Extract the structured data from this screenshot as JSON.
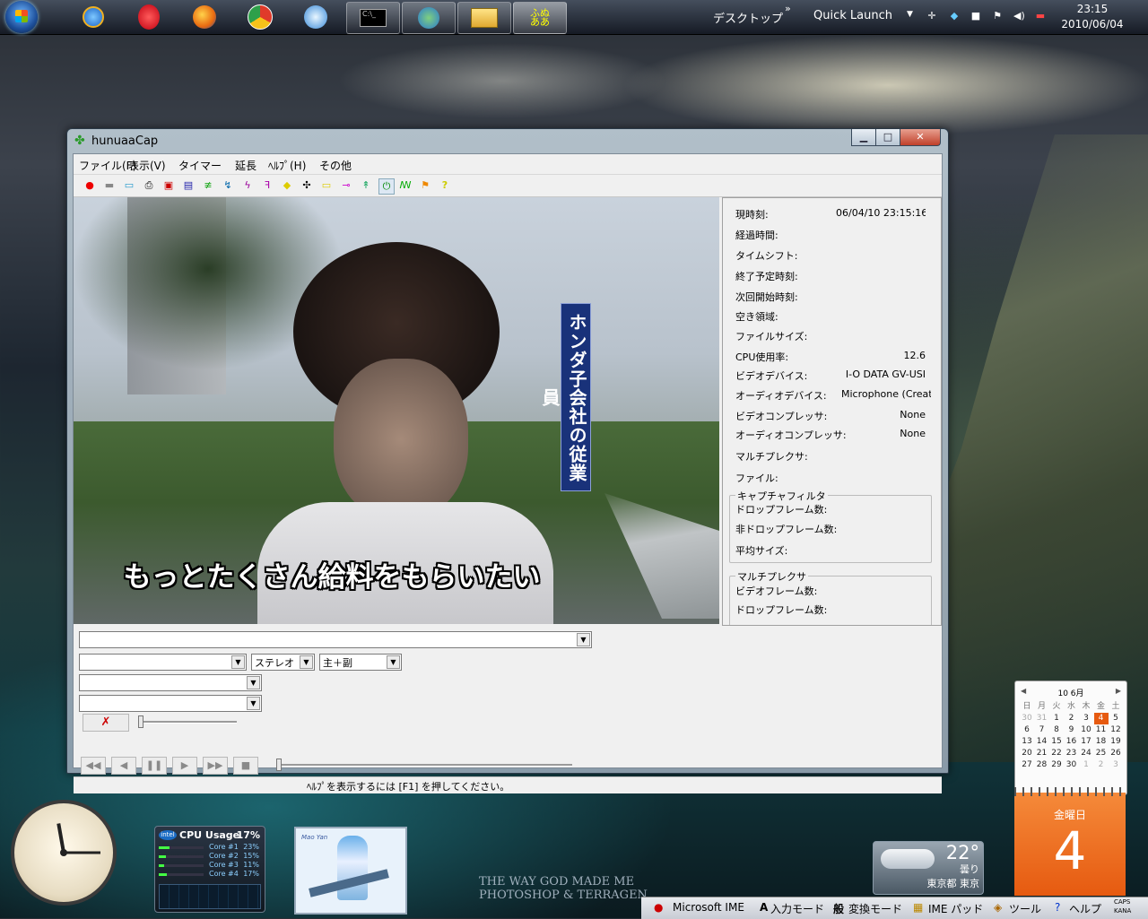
{
  "taskbar": {
    "desktop_label": "デスクトップ",
    "quicklaunch_label": "Quick Launch",
    "time": "23:15",
    "date": "2010/06/04"
  },
  "window": {
    "title": "hunuaaCap",
    "menu": [
      "ファイル(F)",
      "表示(V)",
      "タイマー",
      "延長",
      "ﾍﾙﾌﾟ(H)",
      "その他"
    ]
  },
  "video": {
    "banner": "ホンダ子会社の従業員",
    "subtitle": "もっとたくさん給料をもらいたい"
  },
  "info": {
    "rows": [
      {
        "label": "現時刻:",
        "value": "06/04/10 23:15:16"
      },
      {
        "label": "経過時間:",
        "value": ""
      },
      {
        "label": "タイムシフト:",
        "value": ""
      },
      {
        "label": "終了予定時刻:",
        "value": ""
      },
      {
        "label": "次回開始時刻:",
        "value": ""
      },
      {
        "label": "空き領域:",
        "value": ""
      },
      {
        "label": "ファイルサイズ:",
        "value": ""
      },
      {
        "label": "CPU使用率:",
        "value": "12.6"
      },
      {
        "label": "ビデオデバイス:",
        "value": "I-O DATA GV-USI"
      },
      {
        "label": "オーディオデバイス:",
        "value": "Microphone (Creat"
      },
      {
        "label": "ビデオコンプレッサ:",
        "value": "None"
      },
      {
        "label": "オーディオコンプレッサ:",
        "value": "None"
      },
      {
        "label": "マルチプレクサ:",
        "value": ""
      },
      {
        "label": "ファイル:",
        "value": ""
      }
    ],
    "capture_group": {
      "title": "キャプチャフィルタ",
      "rows": [
        "ドロップフレーム数:",
        "非ドロップフレーム数:",
        "平均サイズ:"
      ]
    },
    "mux_group": {
      "title": "マルチプレクサ",
      "rows": [
        "ビデオフレーム数:",
        "ドロップフレーム数:"
      ]
    }
  },
  "controls": {
    "combo1": "",
    "combo2": "",
    "stereo": "ステレオ",
    "mainsub": "主＋副",
    "combo3": "",
    "combo4": ""
  },
  "status": {
    "text": "ﾍﾙﾌﾟを表示するには [F1] を押してください。"
  },
  "gadgets": {
    "cpu": {
      "brand": "intel",
      "title": "CPU Usage",
      "total": "17%",
      "cores": [
        {
          "name": "Core #1",
          "value": "23%",
          "fraction": 0.23
        },
        {
          "name": "Core #2",
          "value": "15%",
          "fraction": 0.15
        },
        {
          "name": "Core #3",
          "value": "11%",
          "fraction": 0.11
        },
        {
          "name": "Core #4",
          "value": "17%",
          "fraction": 0.17
        }
      ]
    },
    "weather": {
      "temp": "22°",
      "cond": "曇り",
      "place": "東京都 東京"
    },
    "calendar": {
      "header": "10 6月",
      "weekdays": [
        "日",
        "月",
        "火",
        "水",
        "木",
        "金",
        "土"
      ],
      "days": [
        "30",
        "31",
        "1",
        "2",
        "3",
        "4",
        "5",
        "6",
        "7",
        "8",
        "9",
        "10",
        "11",
        "12",
        "13",
        "14",
        "15",
        "16",
        "17",
        "18",
        "19",
        "20",
        "21",
        "22",
        "23",
        "24",
        "25",
        "26",
        "27",
        "28",
        "29",
        "30",
        "1",
        "2",
        "3"
      ],
      "today_index": 5,
      "weekday_label": "金曜日",
      "big_day": "4"
    },
    "watermark": {
      "line1": "THE WAY GOD MADE ME",
      "line2": "PHOTOSHOP & TERRAGEN"
    },
    "photo_caption": "Mao Yan"
  },
  "langbar": {
    "ime": "Microsoft IME",
    "input_mode": "入力モード",
    "convert_mode": "変換モード",
    "ime_pad": "IME パッド",
    "tools": "ツール",
    "help": "ヘルプ",
    "caps": "CAPS",
    "kana": "KANA"
  },
  "colors": {
    "accent": "#e65a10",
    "banner_blue": "#19327a"
  }
}
